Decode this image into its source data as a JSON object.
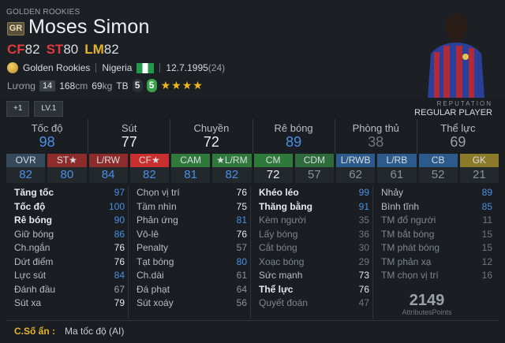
{
  "header": {
    "season": "GOLDEN ROOKIES",
    "season_badge": "GR",
    "player_name": "Moses Simon",
    "positions": [
      {
        "label": "CF",
        "value": "82",
        "color": "#e03a3a"
      },
      {
        "label": "ST",
        "value": "80",
        "color": "#e03a3a"
      },
      {
        "label": "LM",
        "value": "82",
        "color": "#e6b42a"
      }
    ],
    "team_label": "Golden Rookies",
    "nationality": "Nigeria",
    "birthdate": "12.7.1995",
    "age": "(24)",
    "salary_label": "Lương",
    "salary_value": "14",
    "height": "168",
    "height_unit": "cm",
    "weight": "69",
    "weight_unit": "kg",
    "body_type": "TB",
    "weak_foot_left": "5",
    "weak_foot_right": "5",
    "skill_stars": "★★★★"
  },
  "level": {
    "plus": "+1",
    "lv": "LV.1"
  },
  "reputation": {
    "label": "REPUTATION",
    "value": "REGULAR PLAYER"
  },
  "categories": [
    {
      "label": "Tốc độ",
      "value": "98",
      "color": "#4a8fe6"
    },
    {
      "label": "Sút",
      "value": "77",
      "color": "#e9edf0"
    },
    {
      "label": "Chuyền",
      "value": "72",
      "color": "#e9edf0"
    },
    {
      "label": "Rê bóng",
      "value": "89",
      "color": "#4a8fe6"
    },
    {
      "label": "Phòng thủ",
      "value": "38",
      "color": "#6f777e"
    },
    {
      "label": "Thể lực",
      "value": "69",
      "color": "#9aa1a8"
    }
  ],
  "position_ratings": [
    {
      "label": "OVR",
      "value": "82",
      "bg": "#34495c",
      "val_color": "#4a8fe6"
    },
    {
      "label": "ST★",
      "value": "80",
      "bg": "#8e2c2c",
      "val_color": "#4a8fe6"
    },
    {
      "label": "L/RW",
      "value": "84",
      "bg": "#8e2c2c",
      "val_color": "#4a8fe6"
    },
    {
      "label": "CF★",
      "value": "82",
      "bg": "#c92f2f",
      "val_color": "#4a8fe6"
    },
    {
      "label": "CAM",
      "value": "81",
      "bg": "#2f7a3a",
      "val_color": "#4a8fe6"
    },
    {
      "label": "★L/RM",
      "value": "82",
      "bg": "#2f7a3a",
      "val_color": "#4a8fe6"
    },
    {
      "label": "CM",
      "value": "72",
      "bg": "#2f7a3a",
      "val_color": "#e9edf0"
    },
    {
      "label": "CDM",
      "value": "57",
      "bg": "#2f6a3a",
      "val_color": "#8a9197"
    },
    {
      "label": "L/RWB",
      "value": "62",
      "bg": "#2c5a8a",
      "val_color": "#8a9197"
    },
    {
      "label": "L/RB",
      "value": "61",
      "bg": "#2c5a8a",
      "val_color": "#8a9197"
    },
    {
      "label": "CB",
      "value": "52",
      "bg": "#2c5a8a",
      "val_color": "#8a9197"
    },
    {
      "label": "GK",
      "value": "21",
      "bg": "#8a7a2a",
      "val_color": "#8a9197"
    }
  ],
  "stats": {
    "col1": [
      {
        "label": "Tăng tốc",
        "value": "97",
        "bold": true,
        "color": "#4a8fe6"
      },
      {
        "label": "Tốc độ",
        "value": "100",
        "bold": true,
        "color": "#4a8fe6"
      },
      {
        "label": "Rê bóng",
        "value": "90",
        "bold": true,
        "color": "#4a8fe6"
      },
      {
        "label": "Giữ bóng",
        "value": "86",
        "bold": false,
        "color": "#4a8fe6"
      },
      {
        "label": "Ch.ngắn",
        "value": "76",
        "bold": false,
        "color": "#e6eaee"
      },
      {
        "label": "Dứt điểm",
        "value": "76",
        "bold": false,
        "color": "#e6eaee"
      },
      {
        "label": "Lực sút",
        "value": "84",
        "bold": false,
        "color": "#4a8fe6"
      },
      {
        "label": "Đánh đầu",
        "value": "67",
        "bold": false,
        "color": "#9aa1a8"
      },
      {
        "label": "Sút xa",
        "value": "79",
        "bold": false,
        "color": "#e6eaee"
      }
    ],
    "col2": [
      {
        "label": "Chọn vị trí",
        "value": "76",
        "bold": false,
        "color": "#e6eaee"
      },
      {
        "label": "Tầm nhìn",
        "value": "75",
        "bold": false,
        "color": "#e6eaee"
      },
      {
        "label": "Phản ứng",
        "value": "81",
        "bold": false,
        "color": "#4a8fe6"
      },
      {
        "label": "Vô-lê",
        "value": "76",
        "bold": false,
        "color": "#e6eaee"
      },
      {
        "label": "Penalty",
        "value": "57",
        "bold": false,
        "color": "#8a9197"
      },
      {
        "label": "Tạt bóng",
        "value": "80",
        "bold": false,
        "color": "#4a8fe6"
      },
      {
        "label": "Ch.dài",
        "value": "61",
        "bold": false,
        "color": "#8a9197"
      },
      {
        "label": "Đá phạt",
        "value": "64",
        "bold": false,
        "color": "#8a9197"
      },
      {
        "label": "Sút xoáy",
        "value": "56",
        "bold": false,
        "color": "#8a9197"
      }
    ],
    "col3": [
      {
        "label": "Khéo léo",
        "value": "99",
        "bold": true,
        "color": "#4a8fe6"
      },
      {
        "label": "Thăng bằng",
        "value": "91",
        "bold": true,
        "color": "#4a8fe6"
      },
      {
        "label": "Kèm người",
        "value": "35",
        "bold": false,
        "color": "#6f777e"
      },
      {
        "label": "Lấy bóng",
        "value": "36",
        "bold": false,
        "color": "#6f777e"
      },
      {
        "label": "Cắt bóng",
        "value": "30",
        "bold": false,
        "color": "#6f777e"
      },
      {
        "label": "Xoạc bóng",
        "value": "29",
        "bold": false,
        "color": "#6f777e"
      },
      {
        "label": "Sức mạnh",
        "value": "73",
        "bold": false,
        "color": "#e6eaee"
      },
      {
        "label": "Thể lực",
        "value": "76",
        "bold": true,
        "color": "#e6eaee"
      },
      {
        "label": "Quyết đoán",
        "value": "47",
        "bold": false,
        "color": "#6f777e"
      }
    ],
    "col4": [
      {
        "label": "Nhảy",
        "value": "89",
        "bold": false,
        "color": "#4a8fe6"
      },
      {
        "label": "Bình tĩnh",
        "value": "85",
        "bold": false,
        "color": "#4a8fe6"
      },
      {
        "label": "TM đổ người",
        "value": "11",
        "bold": false,
        "color": "#6f777e"
      },
      {
        "label": "TM bắt bóng",
        "value": "15",
        "bold": false,
        "color": "#6f777e"
      },
      {
        "label": "TM phát bóng",
        "value": "15",
        "bold": false,
        "color": "#6f777e"
      },
      {
        "label": "TM phản xạ",
        "value": "12",
        "bold": false,
        "color": "#6f777e"
      },
      {
        "label": "TM chọn vị trí",
        "value": "16",
        "bold": false,
        "color": "#6f777e"
      }
    ]
  },
  "attribute_points": {
    "value": "2149",
    "label": "AttributesPoints"
  },
  "trait": {
    "label": "C.Số ẩn :",
    "value": "Ma tốc độ (AI)"
  }
}
